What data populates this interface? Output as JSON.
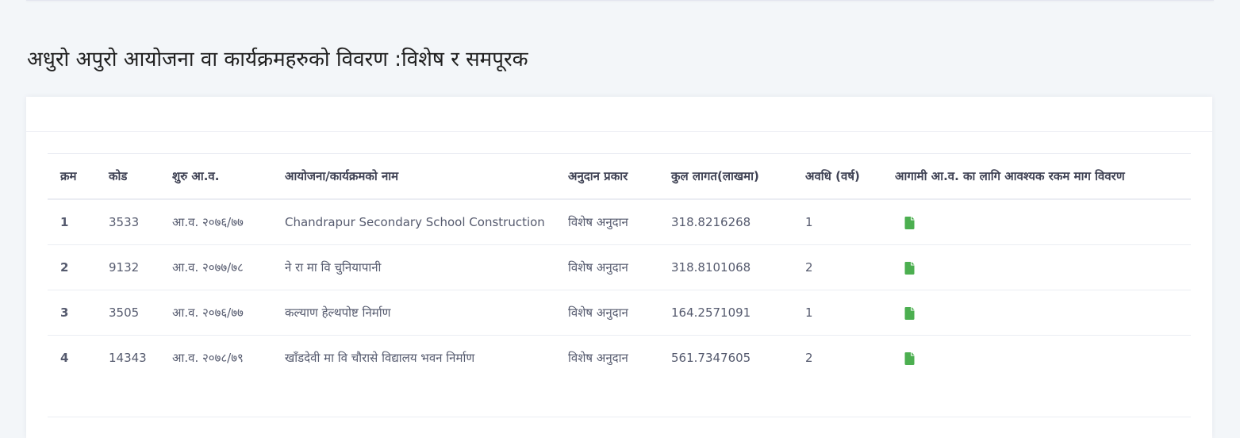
{
  "page": {
    "title": "अधुरो अपुरो आयोजना वा कार्यक्रमहरुको विवरण :विशेष र समपूरक"
  },
  "table": {
    "columns": [
      "क्रम",
      "कोड",
      "शुरु आ.व.",
      "आयोजना/कार्यक्रमको नाम",
      "अनुदान प्रकार",
      "कुल लागत(लाखमा)",
      "अवधि (वर्ष)",
      "आगामी आ.व. का लागि आवश्यक रकम माग विवरण"
    ],
    "rows": [
      {
        "sn": "1",
        "code": "3533",
        "start_fy": "आ.व. २०७६/७७",
        "name": "Chandrapur Secondary School Construction",
        "grant_type": "विशेष अनुदान",
        "total_cost": "318.8216268",
        "duration": "1",
        "demand_icon": "file-icon"
      },
      {
        "sn": "2",
        "code": "9132",
        "start_fy": "आ.व. २०७७/७८",
        "name": "ने रा मा वि चुनियापानी",
        "grant_type": "विशेष अनुदान",
        "total_cost": "318.8101068",
        "duration": "2",
        "demand_icon": "file-icon"
      },
      {
        "sn": "3",
        "code": "3505",
        "start_fy": "आ.व. २०७६/७७",
        "name": "कल्याण हेल्थपोष्ट निर्माण",
        "grant_type": "विशेष अनुदान",
        "total_cost": "164.2571091",
        "duration": "1",
        "demand_icon": "file-icon"
      },
      {
        "sn": "4",
        "code": "14343",
        "start_fy": "आ.व. २०७८/७९",
        "name": "खाँडदेवी मा वि चौरासे विद्यालय भवन निर्माण",
        "grant_type": "विशेष अनुदान",
        "total_cost": "561.7347605",
        "duration": "2",
        "demand_icon": "file-icon"
      }
    ]
  },
  "colors": {
    "background": "#f3f6f9",
    "card": "#ffffff",
    "border": "#ebedf3",
    "icon_green": "#4caf50",
    "title_text": "#212121"
  }
}
